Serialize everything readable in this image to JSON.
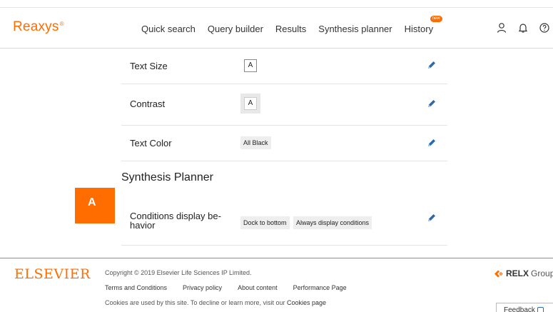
{
  "header": {
    "logo": "Reaxys",
    "logo_mark": "®",
    "nav": [
      "Quick search",
      "Query builder",
      "Results",
      "Synthesis planner",
      "History"
    ],
    "history_badge": "new",
    "icons": [
      "user-icon",
      "bell-icon",
      "help-icon"
    ]
  },
  "settings": {
    "text_size": {
      "label": "Text Size",
      "value": "A"
    },
    "contrast": {
      "label": "Contrast",
      "value": "A"
    },
    "text_color": {
      "label": "Text Color",
      "value": "All Black"
    }
  },
  "synthesis_planner": {
    "title": "Synthesis Planner",
    "marker": "A",
    "conditions_label_line1": "Conditions display be-",
    "conditions_label_line2": "havior",
    "options": [
      "Dock to bottom",
      "Always display conditions"
    ]
  },
  "footer": {
    "brand": "ELSEVIER",
    "copyright": "Copyright © 2019 Elsevier Life Sciences IP Limited.",
    "links": [
      "Terms and Conditions",
      "Privacy policy",
      "About content",
      "Performance Page"
    ],
    "cookies_text": "Cookies are used by this site. To decline or learn more, visit our ",
    "cookies_link": "Cookies page",
    "relx_brand": "RELX",
    "relx_suffix": "Group",
    "feedback": "Feedback"
  },
  "colors": {
    "accent": "#ff6c00",
    "pencil": "#2a6ab0"
  }
}
